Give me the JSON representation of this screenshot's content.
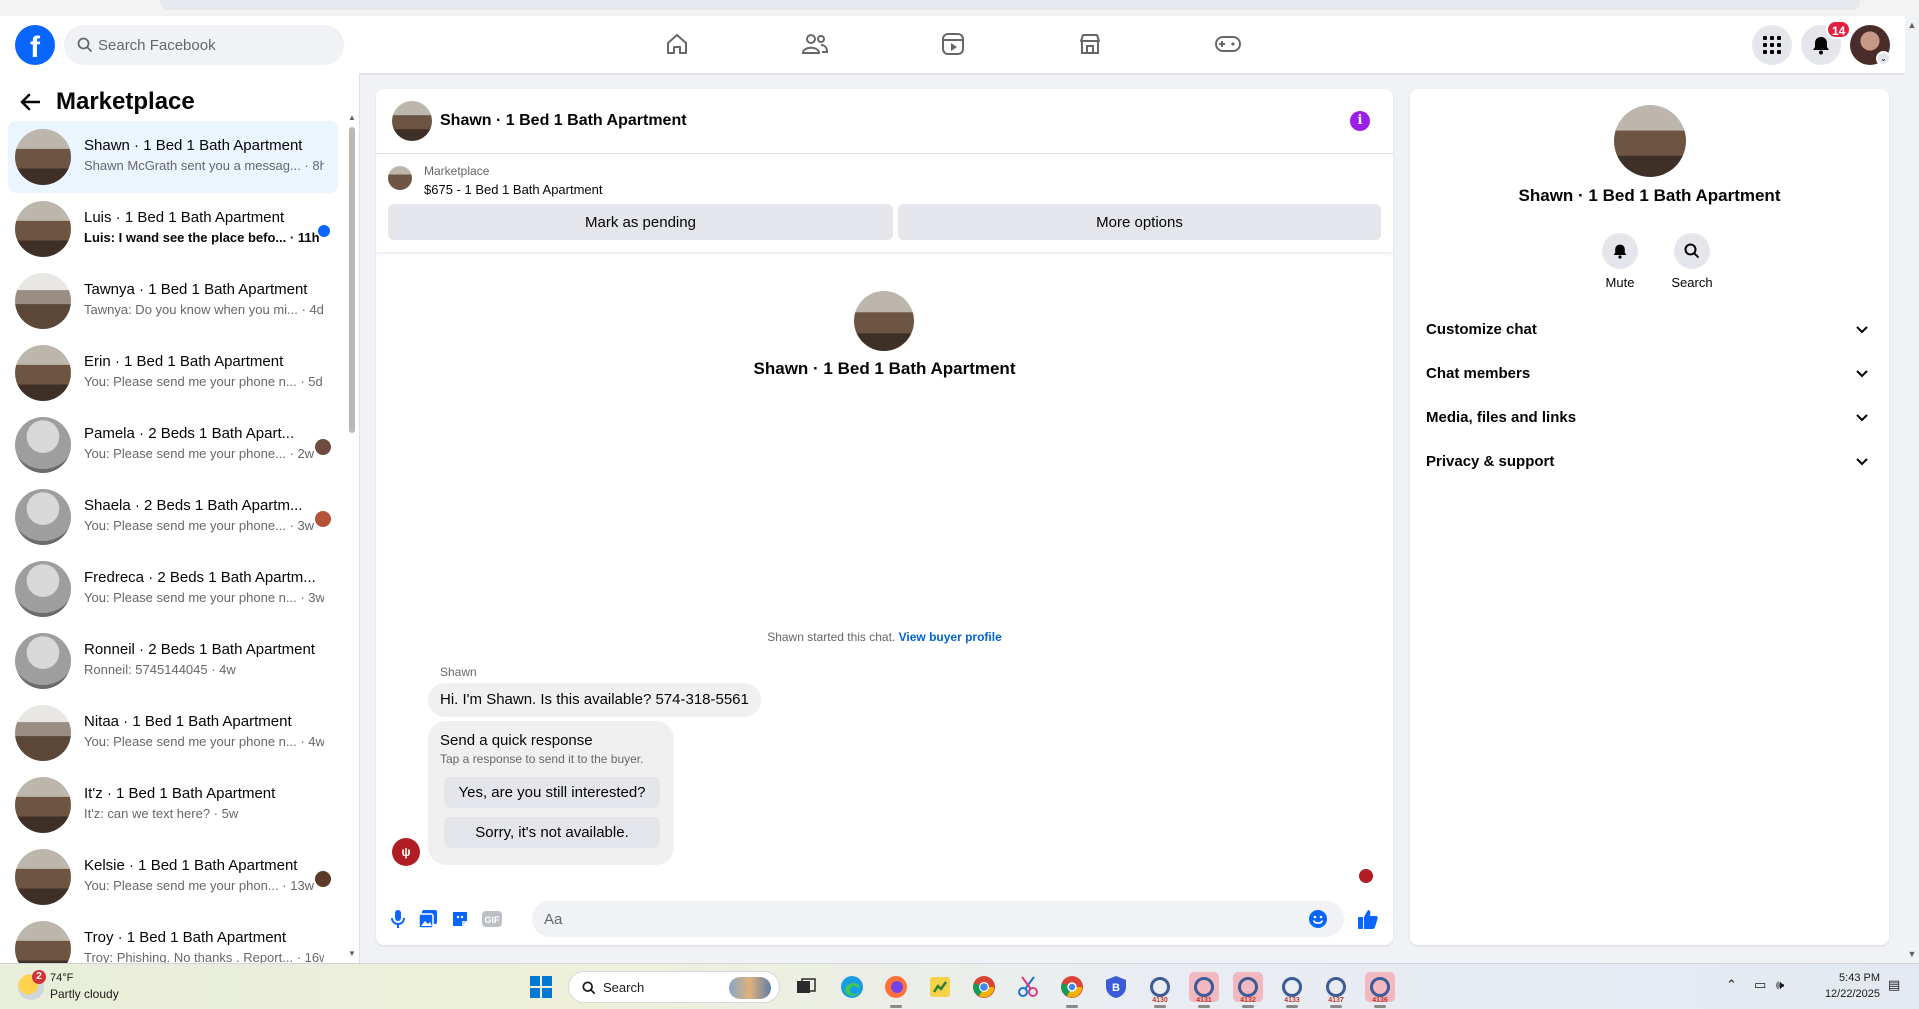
{
  "header": {
    "logo": "f",
    "search_placeholder": "Search Facebook",
    "nav": [
      "home-icon",
      "friends-icon",
      "video-icon",
      "marketplace-icon",
      "gaming-icon"
    ],
    "notifications_count": "14"
  },
  "sidebar": {
    "title": "Marketplace",
    "conversations": [
      {
        "title": "Shawn · 1 Bed 1 Bath Apartment",
        "preview": "Shawn McGrath sent you a messag...",
        "time": "· 8h",
        "active": true
      },
      {
        "title": "Luis · 1 Bed 1 Bath Apartment",
        "preview": "Luis: I wand see the place befo...",
        "time": "· 11h",
        "unread": true
      },
      {
        "title": "Tawnya · 1 Bed 1 Bath Apartment",
        "preview": "Tawnya: Do you know when you mi...",
        "time": "· 4d"
      },
      {
        "title": "Erin · 1 Bed 1 Bath Apartment",
        "preview": "You: Please send me your phone n...",
        "time": "· 5d"
      },
      {
        "title": "Pamela · 2 Beds 1 Bath Apart...",
        "preview": "You: Please send me your phone...",
        "time": "· 2w"
      },
      {
        "title": "Shaela · 2 Beds 1 Bath Apartm...",
        "preview": "You: Please send me your phone...",
        "time": "· 3w"
      },
      {
        "title": "Fredreca · 2 Beds 1 Bath Apartm...",
        "preview": "You: Please send me your phone n...",
        "time": "· 3w"
      },
      {
        "title": "Ronneil · 2 Beds 1 Bath Apartment",
        "preview": "Ronneil: 5745144045",
        "time": "· 4w"
      },
      {
        "title": "Nitaa · 1 Bed 1 Bath Apartment",
        "preview": "You: Please send me your phone n...",
        "time": "· 4w"
      },
      {
        "title": "It'z · 1 Bed 1 Bath Apartment",
        "preview": "It'z: can we text here?",
        "time": "· 5w"
      },
      {
        "title": "Kelsie · 1 Bed 1 Bath Apartment",
        "preview": "You: Please send me your phon...",
        "time": "· 13w"
      },
      {
        "title": "Troy · 1 Bed 1 Bath Apartment",
        "preview": "Troy: Phishing. No thanks . Report...",
        "time": "· 16w"
      }
    ]
  },
  "chat": {
    "title": "Shawn · 1 Bed 1 Bath Apartment",
    "listing_source": "Marketplace",
    "listing_price_title": "$675 - 1 Bed 1 Bath Apartment",
    "mark_pending": "Mark as pending",
    "more_options": "More options",
    "intro_name": "Shawn · 1 Bed 1 Bath Apartment",
    "started_text": "Shawn started this chat.",
    "view_buyer_profile": "View buyer profile",
    "sender_name": "Shawn",
    "message": "Hi. I'm Shawn. Is this available? 574-318-5561",
    "quick_title": "Send a quick response",
    "quick_sub": "Tap a response to send it to the buyer.",
    "quick_reply_1": "Yes, are you still interested?",
    "quick_reply_2": "Sorry, it's not available.",
    "input_placeholder": "Aa"
  },
  "right_panel": {
    "name": "Shawn · 1 Bed 1 Bath Apartment",
    "mute": "Mute",
    "search": "Search",
    "sections": [
      "Customize chat",
      "Chat members",
      "Media, files and links",
      "Privacy & support"
    ]
  },
  "taskbar": {
    "weather_temp": "74°F",
    "weather_desc": "Partly cloudy",
    "weather_badge": "2",
    "search_placeholder": "Search",
    "app_labels": [
      "4130",
      "4131",
      "4132",
      "4133",
      "4137",
      "4136"
    ],
    "time": "5:43 PM",
    "date": "12/22/2025"
  },
  "colors": {
    "facebook_blue": "#0866ff",
    "active_row": "#ebf5ff",
    "link": "#0064d1",
    "badge_red": "#e41e3f",
    "info_purple": "#9b1fe8"
  }
}
